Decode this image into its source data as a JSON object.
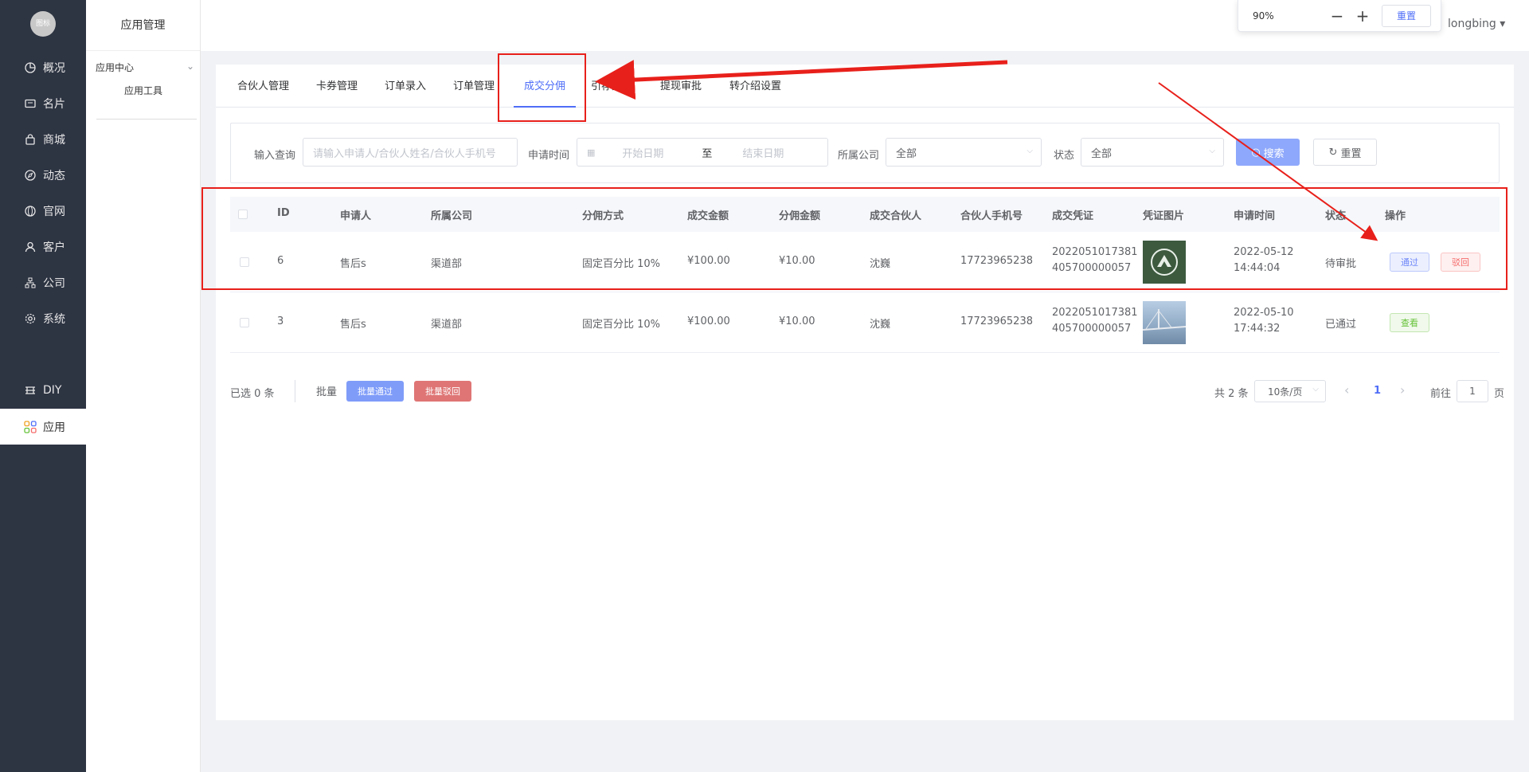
{
  "nav": {
    "logo_text": "图标",
    "items": [
      {
        "label": "概况"
      },
      {
        "label": "名片"
      },
      {
        "label": "商城"
      },
      {
        "label": "动态"
      },
      {
        "label": "官网"
      },
      {
        "label": "客户"
      },
      {
        "label": "公司"
      },
      {
        "label": "系统"
      }
    ],
    "diy": "DIY",
    "app": "应用"
  },
  "subnav": {
    "title": "应用管理",
    "group": "应用中心",
    "leaf": "应用工具"
  },
  "header": {
    "zoom_value": "90%",
    "zoom_minus": "−",
    "zoom_plus": "+",
    "zoom_reset": "重置",
    "user": "longbing ▾"
  },
  "tabs": [
    "合伙人管理",
    "卡券管理",
    "订单录入",
    "订单管理",
    "成交分佣",
    "引荐奖励",
    "提现审批",
    "转介绍设置"
  ],
  "active_tab": "成交分佣",
  "filter": {
    "query_label": "输入查询",
    "query_placeholder": "请输入申请人/合伙人姓名/合伙人手机号",
    "date_label": "申请时间",
    "date_start": "开始日期",
    "date_sep": "至",
    "date_end": "结束日期",
    "company_label": "所属公司",
    "company_value": "全部",
    "status_label": "状态",
    "status_value": "全部",
    "search_btn": "搜索",
    "reset_btn": "重置"
  },
  "table": {
    "columns": [
      "ID",
      "申请人",
      "所属公司",
      "分佣方式",
      "成交金额",
      "分佣金额",
      "成交合伙人",
      "合伙人手机号",
      "成交凭证",
      "凭证图片",
      "申请时间",
      "状态",
      "操作"
    ],
    "rows": [
      {
        "id": "6",
        "applicant": "售后s",
        "company": "渠道部",
        "mode": "固定百分比 10%",
        "amount": "¥100.00",
        "commission": "¥10.00",
        "partner": "沈巍",
        "phone": "17723965238",
        "voucher_l1": "2022051017381",
        "voucher_l2": "405700000057",
        "date": "2022-05-12",
        "time": "14:44:04",
        "status": "待审批",
        "actions": [
          "通过",
          "驳回"
        ]
      },
      {
        "id": "3",
        "applicant": "售后s",
        "company": "渠道部",
        "mode": "固定百分比 10%",
        "amount": "¥100.00",
        "commission": "¥10.00",
        "partner": "沈巍",
        "phone": "17723965238",
        "voucher_l1": "2022051017381",
        "voucher_l2": "405700000057",
        "date": "2022-05-10",
        "time": "17:44:32",
        "status": "已通过",
        "actions": [
          "查看"
        ]
      }
    ]
  },
  "footer": {
    "selected": "已选 0 条",
    "batch_label": "批量",
    "batch_pass": "批量通过",
    "batch_reject": "批量驳回",
    "total": "共 2 条",
    "page_size": "10条/页",
    "prev": "‹",
    "current_page": "1",
    "next": "›",
    "goto_label": "前往",
    "goto_value": "1",
    "page_unit": "页"
  },
  "colors": {
    "primary": "#4f6ef7",
    "annotation": "#e8201b",
    "sidebar": "#2d3442"
  }
}
